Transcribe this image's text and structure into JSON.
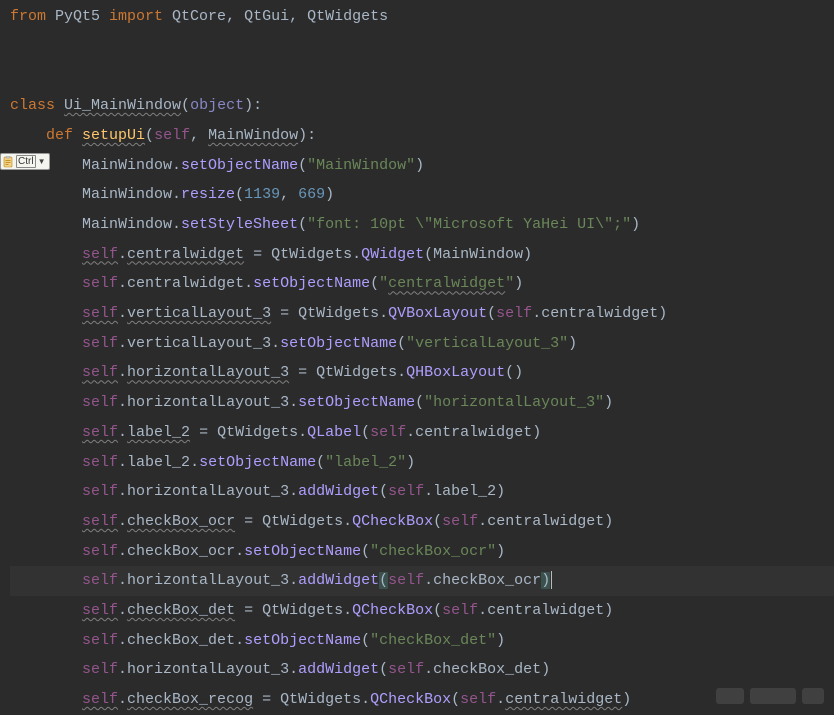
{
  "popup": {
    "label": "Ctrl",
    "icon_name": "clipboard-icon"
  },
  "code": {
    "lines": [
      {
        "indent": 0,
        "spans": [
          {
            "t": "from ",
            "c": "kw"
          },
          {
            "t": "PyQt5 ",
            "c": "ident"
          },
          {
            "t": "import ",
            "c": "kw"
          },
          {
            "t": "QtCore",
            "c": "ident"
          },
          {
            "t": ", ",
            "c": "punc"
          },
          {
            "t": "QtGui",
            "c": "ident"
          },
          {
            "t": ", ",
            "c": "punc"
          },
          {
            "t": "QtWidgets",
            "c": "ident"
          }
        ]
      },
      {
        "indent": 0,
        "blank": true
      },
      {
        "indent": 0,
        "blank": true
      },
      {
        "indent": 0,
        "spans": [
          {
            "t": "class ",
            "c": "kw"
          },
          {
            "t": "Ui_MainWindow",
            "c": "cls wavy"
          },
          {
            "t": "(",
            "c": "punc"
          },
          {
            "t": "object",
            "c": "builtin"
          },
          {
            "t": "):",
            "c": "punc"
          }
        ]
      },
      {
        "indent": 1,
        "spans": [
          {
            "t": "def ",
            "c": "kw"
          },
          {
            "t": "setupUi",
            "c": "func wavy"
          },
          {
            "t": "(",
            "c": "punc"
          },
          {
            "t": "self",
            "c": "self"
          },
          {
            "t": ", ",
            "c": "punc"
          },
          {
            "t": "MainWindow",
            "c": "ident wavy"
          },
          {
            "t": "):",
            "c": "punc"
          }
        ]
      },
      {
        "indent": 2,
        "spans": [
          {
            "t": "MainWindow",
            "c": "ident"
          },
          {
            "t": ".",
            "c": "punc"
          },
          {
            "t": "setObjectName",
            "c": "funcb"
          },
          {
            "t": "(",
            "c": "punc"
          },
          {
            "t": "\"MainWindow\"",
            "c": "str"
          },
          {
            "t": ")",
            "c": "punc"
          }
        ]
      },
      {
        "indent": 2,
        "spans": [
          {
            "t": "MainWindow",
            "c": "ident"
          },
          {
            "t": ".",
            "c": "punc"
          },
          {
            "t": "resize",
            "c": "funcb"
          },
          {
            "t": "(",
            "c": "punc"
          },
          {
            "t": "1139",
            "c": "num"
          },
          {
            "t": ", ",
            "c": "punc"
          },
          {
            "t": "669",
            "c": "num"
          },
          {
            "t": ")",
            "c": "punc"
          }
        ]
      },
      {
        "indent": 2,
        "spans": [
          {
            "t": "MainWindow",
            "c": "ident"
          },
          {
            "t": ".",
            "c": "punc"
          },
          {
            "t": "setStyleSheet",
            "c": "funcb"
          },
          {
            "t": "(",
            "c": "punc"
          },
          {
            "t": "\"font: 10pt \\\"Microsoft YaHei UI\\\";\"",
            "c": "str"
          },
          {
            "t": ")",
            "c": "punc"
          }
        ]
      },
      {
        "indent": 2,
        "spans": [
          {
            "t": "self",
            "c": "self wavy"
          },
          {
            "t": ".",
            "c": "punc"
          },
          {
            "t": "centralwidget",
            "c": "ident lbl"
          },
          {
            "t": " = ",
            "c": "punc"
          },
          {
            "t": "QtWidgets",
            "c": "ident"
          },
          {
            "t": ".",
            "c": "punc"
          },
          {
            "t": "QWidget",
            "c": "funcb"
          },
          {
            "t": "(",
            "c": "punc"
          },
          {
            "t": "MainWindow",
            "c": "ident"
          },
          {
            "t": ")",
            "c": "punc"
          }
        ]
      },
      {
        "indent": 2,
        "spans": [
          {
            "t": "self",
            "c": "self"
          },
          {
            "t": ".",
            "c": "punc"
          },
          {
            "t": "centralwidget",
            "c": "ident"
          },
          {
            "t": ".",
            "c": "punc"
          },
          {
            "t": "setObjectName",
            "c": "funcb"
          },
          {
            "t": "(",
            "c": "punc"
          },
          {
            "t": "\"",
            "c": "str"
          },
          {
            "t": "centralwidget",
            "c": "str wavy"
          },
          {
            "t": "\"",
            "c": "str"
          },
          {
            "t": ")",
            "c": "punc"
          }
        ]
      },
      {
        "indent": 2,
        "spans": [
          {
            "t": "self",
            "c": "self wavy"
          },
          {
            "t": ".",
            "c": "punc"
          },
          {
            "t": "verticalLayout_3",
            "c": "ident lbl"
          },
          {
            "t": " = ",
            "c": "punc"
          },
          {
            "t": "QtWidgets",
            "c": "ident"
          },
          {
            "t": ".",
            "c": "punc"
          },
          {
            "t": "QVBoxLayout",
            "c": "funcb"
          },
          {
            "t": "(",
            "c": "punc"
          },
          {
            "t": "self",
            "c": "self"
          },
          {
            "t": ".",
            "c": "punc"
          },
          {
            "t": "centralwidget",
            "c": "ident"
          },
          {
            "t": ")",
            "c": "punc"
          }
        ]
      },
      {
        "indent": 2,
        "spans": [
          {
            "t": "self",
            "c": "self"
          },
          {
            "t": ".",
            "c": "punc"
          },
          {
            "t": "verticalLayout_3",
            "c": "ident"
          },
          {
            "t": ".",
            "c": "punc"
          },
          {
            "t": "setObjectName",
            "c": "funcb"
          },
          {
            "t": "(",
            "c": "punc"
          },
          {
            "t": "\"verticalLayout_3\"",
            "c": "str"
          },
          {
            "t": ")",
            "c": "punc"
          }
        ]
      },
      {
        "indent": 2,
        "spans": [
          {
            "t": "self",
            "c": "self wavy"
          },
          {
            "t": ".",
            "c": "punc"
          },
          {
            "t": "horizontalLayout_3",
            "c": "ident lbl"
          },
          {
            "t": " = ",
            "c": "punc"
          },
          {
            "t": "QtWidgets",
            "c": "ident"
          },
          {
            "t": ".",
            "c": "punc"
          },
          {
            "t": "QHBoxLayout",
            "c": "funcb"
          },
          {
            "t": "()",
            "c": "punc"
          }
        ]
      },
      {
        "indent": 2,
        "spans": [
          {
            "t": "self",
            "c": "self"
          },
          {
            "t": ".",
            "c": "punc"
          },
          {
            "t": "horizontalLayout_3",
            "c": "ident"
          },
          {
            "t": ".",
            "c": "punc"
          },
          {
            "t": "setObjectName",
            "c": "funcb"
          },
          {
            "t": "(",
            "c": "punc"
          },
          {
            "t": "\"horizontalLayout_3\"",
            "c": "str"
          },
          {
            "t": ")",
            "c": "punc"
          }
        ]
      },
      {
        "indent": 2,
        "spans": [
          {
            "t": "self",
            "c": "self wavy"
          },
          {
            "t": ".",
            "c": "punc"
          },
          {
            "t": "label_2",
            "c": "ident lbl"
          },
          {
            "t": " = ",
            "c": "punc"
          },
          {
            "t": "QtWidgets",
            "c": "ident"
          },
          {
            "t": ".",
            "c": "punc"
          },
          {
            "t": "QLabel",
            "c": "funcb"
          },
          {
            "t": "(",
            "c": "punc"
          },
          {
            "t": "self",
            "c": "self"
          },
          {
            "t": ".",
            "c": "punc"
          },
          {
            "t": "centralwidget",
            "c": "ident"
          },
          {
            "t": ")",
            "c": "punc"
          }
        ]
      },
      {
        "indent": 2,
        "spans": [
          {
            "t": "self",
            "c": "self"
          },
          {
            "t": ".",
            "c": "punc"
          },
          {
            "t": "label_2",
            "c": "ident"
          },
          {
            "t": ".",
            "c": "punc"
          },
          {
            "t": "setObjectName",
            "c": "funcb"
          },
          {
            "t": "(",
            "c": "punc"
          },
          {
            "t": "\"label_2\"",
            "c": "str"
          },
          {
            "t": ")",
            "c": "punc"
          }
        ]
      },
      {
        "indent": 2,
        "spans": [
          {
            "t": "self",
            "c": "self"
          },
          {
            "t": ".",
            "c": "punc"
          },
          {
            "t": "horizontalLayout_3",
            "c": "ident"
          },
          {
            "t": ".",
            "c": "punc"
          },
          {
            "t": "addWidget",
            "c": "funcb"
          },
          {
            "t": "(",
            "c": "punc"
          },
          {
            "t": "self",
            "c": "self"
          },
          {
            "t": ".",
            "c": "punc"
          },
          {
            "t": "label_2",
            "c": "ident"
          },
          {
            "t": ")",
            "c": "punc"
          }
        ]
      },
      {
        "indent": 2,
        "spans": [
          {
            "t": "self",
            "c": "self wavy"
          },
          {
            "t": ".",
            "c": "punc"
          },
          {
            "t": "checkBox_ocr",
            "c": "ident lbl"
          },
          {
            "t": " = ",
            "c": "punc"
          },
          {
            "t": "QtWidgets",
            "c": "ident"
          },
          {
            "t": ".",
            "c": "punc"
          },
          {
            "t": "QCheckBox",
            "c": "funcb"
          },
          {
            "t": "(",
            "c": "punc"
          },
          {
            "t": "self",
            "c": "self"
          },
          {
            "t": ".",
            "c": "punc"
          },
          {
            "t": "centralwidget",
            "c": "ident"
          },
          {
            "t": ")",
            "c": "punc"
          }
        ]
      },
      {
        "indent": 2,
        "spans": [
          {
            "t": "self",
            "c": "self"
          },
          {
            "t": ".",
            "c": "punc"
          },
          {
            "t": "checkBox_ocr",
            "c": "ident"
          },
          {
            "t": ".",
            "c": "punc"
          },
          {
            "t": "setObjectName",
            "c": "funcb"
          },
          {
            "t": "(",
            "c": "punc"
          },
          {
            "t": "\"checkBox_ocr\"",
            "c": "str"
          },
          {
            "t": ")",
            "c": "punc"
          }
        ]
      },
      {
        "indent": 2,
        "highlight": true,
        "spans": [
          {
            "t": "self",
            "c": "self"
          },
          {
            "t": ".",
            "c": "punc"
          },
          {
            "t": "horizontalLayout_3",
            "c": "ident"
          },
          {
            "t": ".",
            "c": "punc"
          },
          {
            "t": "addWidget",
            "c": "funcb"
          },
          {
            "t": "(",
            "c": "punc paren-hl"
          },
          {
            "t": "self",
            "c": "self"
          },
          {
            "t": ".",
            "c": "punc"
          },
          {
            "t": "checkBox_ocr",
            "c": "ident"
          },
          {
            "t": ")",
            "c": "punc paren-hl"
          },
          {
            "t": "",
            "c": "cursor-holder"
          }
        ]
      },
      {
        "indent": 2,
        "spans": [
          {
            "t": "self",
            "c": "self wavy"
          },
          {
            "t": ".",
            "c": "punc"
          },
          {
            "t": "checkBox_det",
            "c": "ident lbl"
          },
          {
            "t": " = ",
            "c": "punc"
          },
          {
            "t": "QtWidgets",
            "c": "ident"
          },
          {
            "t": ".",
            "c": "punc"
          },
          {
            "t": "QCheckBox",
            "c": "funcb"
          },
          {
            "t": "(",
            "c": "punc"
          },
          {
            "t": "self",
            "c": "self"
          },
          {
            "t": ".",
            "c": "punc"
          },
          {
            "t": "centralwidget",
            "c": "ident"
          },
          {
            "t": ")",
            "c": "punc"
          }
        ]
      },
      {
        "indent": 2,
        "spans": [
          {
            "t": "self",
            "c": "self"
          },
          {
            "t": ".",
            "c": "punc"
          },
          {
            "t": "checkBox_det",
            "c": "ident"
          },
          {
            "t": ".",
            "c": "punc"
          },
          {
            "t": "setObjectName",
            "c": "funcb"
          },
          {
            "t": "(",
            "c": "punc"
          },
          {
            "t": "\"checkBox_det\"",
            "c": "str"
          },
          {
            "t": ")",
            "c": "punc"
          }
        ]
      },
      {
        "indent": 2,
        "spans": [
          {
            "t": "self",
            "c": "self"
          },
          {
            "t": ".",
            "c": "punc"
          },
          {
            "t": "horizontalLayout_3",
            "c": "ident"
          },
          {
            "t": ".",
            "c": "punc"
          },
          {
            "t": "addWidget",
            "c": "funcb"
          },
          {
            "t": "(",
            "c": "punc"
          },
          {
            "t": "self",
            "c": "self"
          },
          {
            "t": ".",
            "c": "punc"
          },
          {
            "t": "checkBox_det",
            "c": "ident"
          },
          {
            "t": ")",
            "c": "punc"
          }
        ]
      },
      {
        "indent": 2,
        "spans": [
          {
            "t": "self",
            "c": "self wavy"
          },
          {
            "t": ".",
            "c": "punc"
          },
          {
            "t": "checkBox_recog",
            "c": "ident lbl"
          },
          {
            "t": " = ",
            "c": "punc"
          },
          {
            "t": "QtWidgets",
            "c": "ident"
          },
          {
            "t": ".",
            "c": "punc"
          },
          {
            "t": "QCheckBox",
            "c": "funcb"
          },
          {
            "t": "(",
            "c": "punc"
          },
          {
            "t": "self",
            "c": "self"
          },
          {
            "t": ".",
            "c": "punc"
          },
          {
            "t": "centralwidget",
            "c": "ident wavy"
          },
          {
            "t": ")",
            "c": "punc"
          }
        ]
      }
    ]
  }
}
